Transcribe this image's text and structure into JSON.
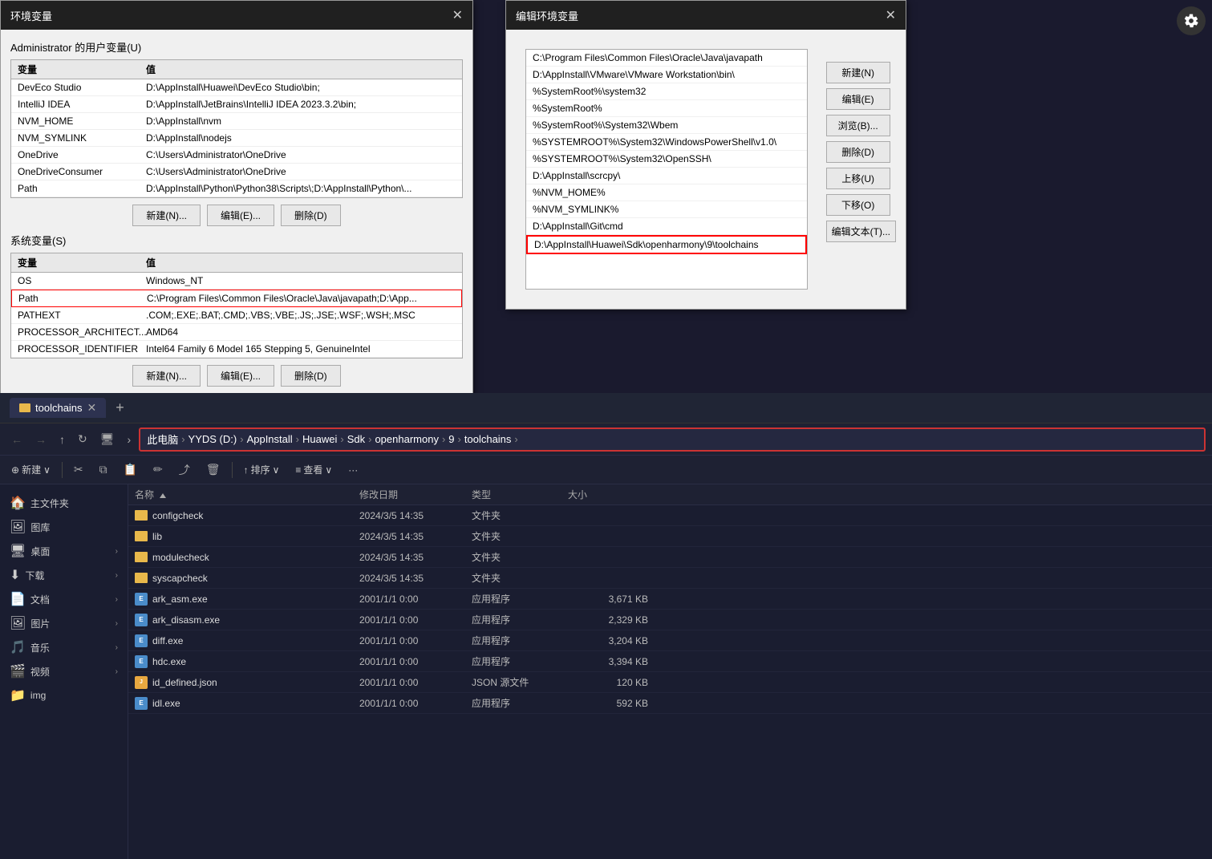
{
  "envDialog": {
    "title": "环境变量",
    "closeBtn": "✕",
    "userVarsLabel": "Administrator 的用户变量(U)",
    "userVarsHeader": [
      "变量",
      "值"
    ],
    "userVars": [
      {
        "name": "DevEco Studio",
        "value": "D:\\AppInstall\\Huawei\\DevEco Studio\\bin;",
        "selected": false
      },
      {
        "name": "IntelliJ IDEA",
        "value": "D:\\AppInstall\\JetBrains\\IntelliJ IDEA 2023.3.2\\bin;",
        "selected": false
      },
      {
        "name": "NVM_HOME",
        "value": "D:\\AppInstall\\nvm",
        "selected": false
      },
      {
        "name": "NVM_SYMLINK",
        "value": "D:\\AppInstall\\nodejs",
        "selected": false
      },
      {
        "name": "OneDrive",
        "value": "C:\\Users\\Administrator\\OneDrive",
        "selected": false
      },
      {
        "name": "OneDriveConsumer",
        "value": "C:\\Users\\Administrator\\OneDrive",
        "selected": false
      },
      {
        "name": "Path",
        "value": "D:\\AppInstall\\Python\\Python38\\Scripts\\;D:\\AppInstall\\Python\\...",
        "selected": false
      }
    ],
    "userBtns": [
      "新建(N)...",
      "编辑(E)...",
      "删除(D)"
    ],
    "sysVarsLabel": "系统变量(S)",
    "sysVarsHeader": [
      "变量",
      "值"
    ],
    "sysVars": [
      {
        "name": "OS",
        "value": "Windows_NT",
        "selected": false,
        "highlighted": false
      },
      {
        "name": "Path",
        "value": "C:\\Program Files\\Common Files\\Oracle\\Java\\javapath;D:\\App...",
        "selected": false,
        "highlighted": true
      },
      {
        "name": "PATHEXT",
        "value": ".COM;.EXE;.BAT;.CMD;.VBS;.VBE;.JS;.JSE;.WSF;.WSH;.MSC",
        "selected": false,
        "highlighted": false
      },
      {
        "name": "PROCESSOR_ARCHITECT...",
        "value": "AMD64",
        "selected": false,
        "highlighted": false
      },
      {
        "name": "PROCESSOR_IDENTIFIER",
        "value": "Intel64 Family 6 Model 165 Stepping 5, GenuineIntel",
        "selected": false,
        "highlighted": false
      }
    ],
    "sysBtns": [
      "新建(N)...",
      "编辑(E)...",
      "删除(D)"
    ]
  },
  "editDialog": {
    "title": "编辑环境变量",
    "closeBtn": "✕",
    "paths": [
      "C:\\Program Files\\Common Files\\Oracle\\Java\\javapath",
      "D:\\AppInstall\\VMware\\VMware Workstation\\bin\\",
      "%SystemRoot%\\system32",
      "%SystemRoot%",
      "%SystemRoot%\\System32\\Wbem",
      "%SYSTEMROOT%\\System32\\WindowsPowerShell\\v1.0\\",
      "%SYSTEMROOT%\\System32\\OpenSSH\\",
      "D:\\AppInstall\\scrcpy\\",
      "%NVM_HOME%",
      "%NVM_SYMLINK%",
      "D:\\AppInstall\\Git\\cmd",
      "D:\\AppInstall\\Huawei\\Sdk\\openharmony\\9\\toolchains"
    ],
    "highlightedIndex": 11,
    "btns": [
      "新建(N)",
      "编辑(E)",
      "浏览(B)...",
      "删除(D)",
      "上移(U)",
      "下移(O)",
      "编辑文本(T)..."
    ]
  },
  "explorer": {
    "tabLabel": "toolchains",
    "tabClose": "✕",
    "tabAdd": "+",
    "navBtns": [
      "←",
      "→",
      "↑",
      "↻"
    ],
    "breadcrumb": {
      "items": [
        "此电脑",
        "YYDS (D:)",
        "AppInstall",
        "Huawei",
        "Sdk",
        "openharmony",
        "9",
        "toolchains"
      ],
      "highlighted": true
    },
    "toolbar": {
      "newBtn": "⊕ 新建",
      "newArrow": "∨",
      "cutIcon": "✂",
      "copyIcon": "⧉",
      "pasteIcon": "📋",
      "renameIcon": "✏",
      "shareIcon": "⤴",
      "deleteIcon": "🗑",
      "sortBtn": "↑ 排序",
      "sortArrow": "∨",
      "viewBtn": "≡ 查看",
      "viewArrow": "∨",
      "moreBtn": "···"
    },
    "sidebar": [
      {
        "icon": "🏠",
        "label": "主文件夹"
      },
      {
        "icon": "🖼",
        "label": "图库"
      },
      {
        "icon": "🖥",
        "label": "桌面",
        "arrow": "›"
      },
      {
        "icon": "⬇",
        "label": "下载",
        "arrow": "›"
      },
      {
        "icon": "📄",
        "label": "文档",
        "arrow": "›"
      },
      {
        "icon": "🖼",
        "label": "图片",
        "arrow": "›"
      },
      {
        "icon": "🎵",
        "label": "音乐",
        "arrow": "›"
      },
      {
        "icon": "🎬",
        "label": "视频",
        "arrow": "›"
      },
      {
        "icon": "📁",
        "label": "img"
      }
    ],
    "fileHeaders": [
      "名称",
      "修改日期",
      "类型",
      "大小"
    ],
    "files": [
      {
        "name": "configcheck",
        "date": "2024/3/5 14:35",
        "type": "文件夹",
        "size": "",
        "kind": "folder"
      },
      {
        "name": "lib",
        "date": "2024/3/5 14:35",
        "type": "文件夹",
        "size": "",
        "kind": "folder"
      },
      {
        "name": "modulecheck",
        "date": "2024/3/5 14:35",
        "type": "文件夹",
        "size": "",
        "kind": "folder"
      },
      {
        "name": "syscapcheck",
        "date": "2024/3/5 14:35",
        "type": "文件夹",
        "size": "",
        "kind": "folder"
      },
      {
        "name": "ark_asm.exe",
        "date": "2001/1/1 0:00",
        "type": "应用程序",
        "size": "3,671 KB",
        "kind": "exe"
      },
      {
        "name": "ark_disasm.exe",
        "date": "2001/1/1 0:00",
        "type": "应用程序",
        "size": "2,329 KB",
        "kind": "exe"
      },
      {
        "name": "diff.exe",
        "date": "2001/1/1 0:00",
        "type": "应用程序",
        "size": "3,204 KB",
        "kind": "exe"
      },
      {
        "name": "hdc.exe",
        "date": "2001/1/1 0:00",
        "type": "应用程序",
        "size": "3,394 KB",
        "kind": "exe"
      },
      {
        "name": "id_defined.json",
        "date": "2001/1/1 0:00",
        "type": "JSON 源文件",
        "size": "120 KB",
        "kind": "json"
      },
      {
        "name": "idl.exe",
        "date": "2001/1/1 0:00",
        "type": "应用程序",
        "size": "592 KB",
        "kind": "exe"
      }
    ]
  }
}
